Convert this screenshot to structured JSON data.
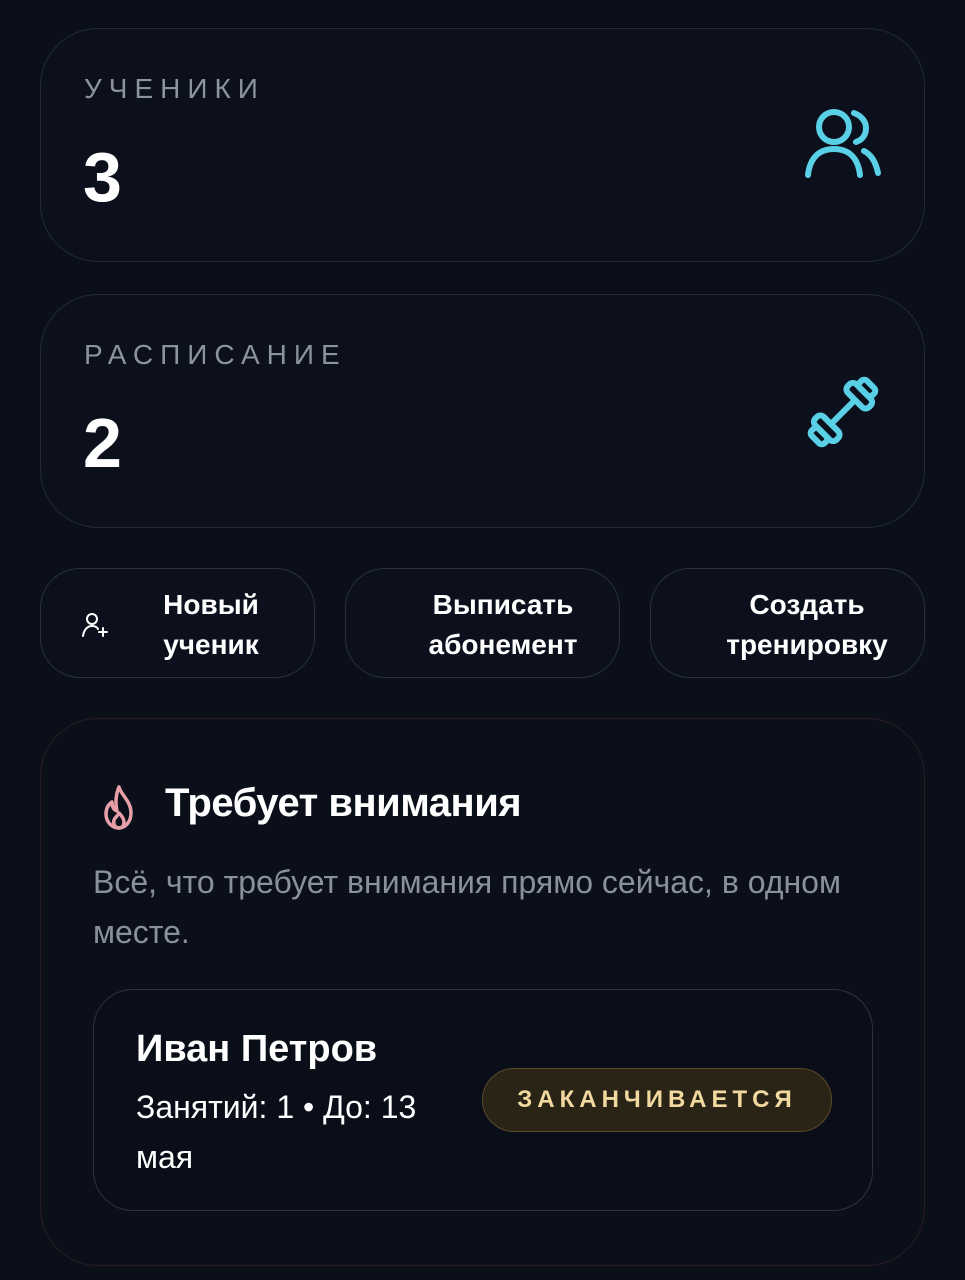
{
  "stats": {
    "students": {
      "label": "УЧЕНИКИ",
      "value": "3",
      "icon": "users-icon"
    },
    "schedule": {
      "label": "РАСПИСАНИЕ",
      "value": "2",
      "icon": "dumbbell-icon"
    }
  },
  "actions": {
    "new_student": {
      "line1": "Новый",
      "line2": "ученик",
      "icon": "user-plus-icon"
    },
    "issue_subscription": {
      "line1": "Выписать",
      "line2": "абонемент"
    },
    "create_workout": {
      "line1": "Создать",
      "line2": "тренировку"
    }
  },
  "attention": {
    "title": "Требует внимания",
    "icon": "flame-icon",
    "description": "Всё, что требует внимания прямо сейчас, в одном месте.",
    "items": [
      {
        "name": "Иван Петров",
        "meta": "Занятий: 1 • До: 13 мая",
        "badge": "ЗАКАНЧИВАЕТСЯ"
      }
    ]
  },
  "colors": {
    "background": "#0a0f1a",
    "accent_icon": "#5ad0e6",
    "flame_icon": "#e8a0a8",
    "badge_text": "#f2d9a0",
    "badge_bg": "#2a2417"
  }
}
